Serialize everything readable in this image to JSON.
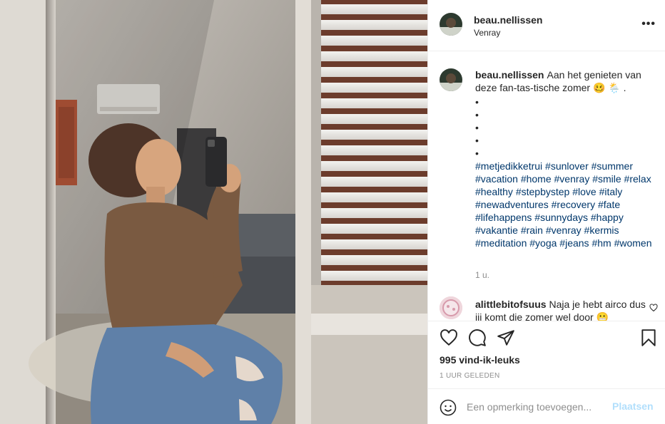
{
  "post": {
    "username": "beau.nellissen",
    "location": "Venray",
    "more_icon": "•••",
    "caption_text": "Aan het genieten van deze fan-tas-tische zomer 🥴 🌦️ .",
    "dots": [
      "•",
      "•",
      "•",
      "•",
      "•"
    ],
    "hashtags": "#metjedikketrui #sunlover #summer #vacation #home #venray #smile #relax #healthy #stepbystep #love #italy #newadventures #recovery #fate #lifehappens #sunnydays #happy #vakantie #rain #venray #kermis #meditation #yoga #jeans #hm #women",
    "time_ago": "1 u.",
    "likes": "995 vind-ik-leuks",
    "posted": "1 UUR GELEDEN"
  },
  "comment": {
    "username": "alittlebitofsuus",
    "text": "Naja je hebt airco dus jij komt die zomer wel door 😬"
  },
  "add_comment": {
    "placeholder": "Een opmerking toevoegen...",
    "post_label": "Plaatsen"
  },
  "icons": [
    "heart-icon",
    "comment-icon",
    "share-icon",
    "bookmark-icon",
    "emoji-icon",
    "more-icon"
  ],
  "colors": {
    "hashtag": "#00376b",
    "muted": "#8e8e8e",
    "text": "#262626",
    "post_button": "#b2dffc",
    "divider": "#efefef"
  }
}
